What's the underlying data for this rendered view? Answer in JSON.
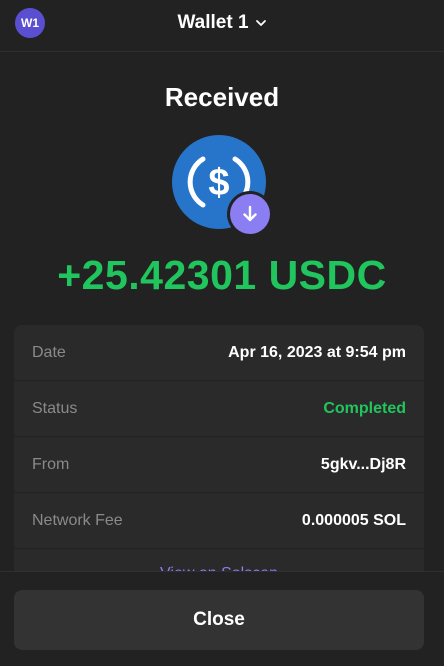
{
  "header": {
    "avatar_text": "W1",
    "wallet_name": "Wallet 1",
    "chevron_icon": "chevron-down-icon"
  },
  "title": "Received",
  "token": {
    "icon": "usdc-coin-icon",
    "badge_icon": "arrow-down-icon",
    "brand_color": "#2775ca",
    "badge_color": "#8b7df2"
  },
  "amount": "+25.42301 USDC",
  "details": [
    {
      "label": "Date",
      "value": "Apr 16, 2023 at 9:54 pm"
    },
    {
      "label": "Status",
      "value": "Completed"
    },
    {
      "label": "From",
      "value": "5gkv...Dj8R"
    },
    {
      "label": "Network Fee",
      "value": "0.000005 SOL"
    }
  ],
  "explorer_link": "View on Solscan",
  "close_label": "Close",
  "colors": {
    "background": "#222222",
    "card": "#2a2a2a",
    "success": "#21c55d",
    "accent": "#8b7df2",
    "button": "#333333"
  }
}
